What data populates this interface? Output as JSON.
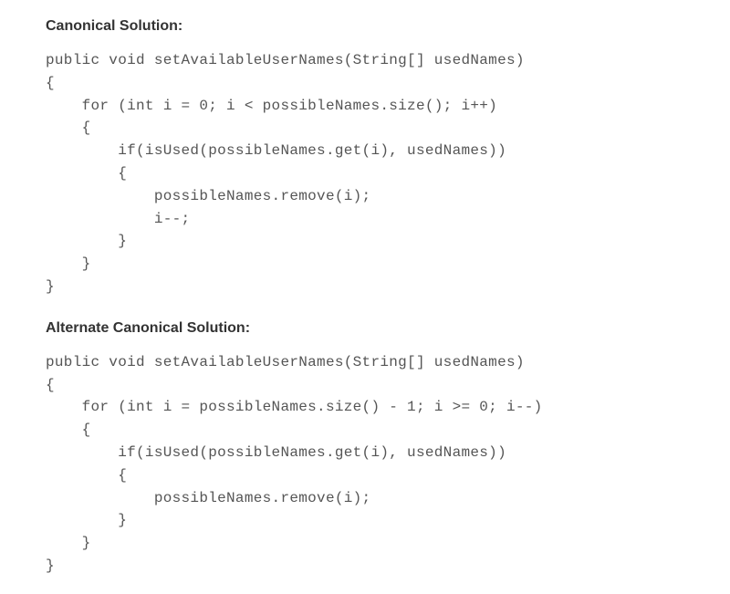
{
  "section1": {
    "heading": "Canonical Solution:",
    "code": "public void setAvailableUserNames(String[] usedNames)\n{\n    for (int i = 0; i < possibleNames.size(); i++)\n    {\n        if(isUsed(possibleNames.get(i), usedNames))\n        {\n            possibleNames.remove(i);\n            i--;\n        }\n    }\n}"
  },
  "section2": {
    "heading": "Alternate Canonical Solution:",
    "code": "public void setAvailableUserNames(String[] usedNames)\n{\n    for (int i = possibleNames.size() - 1; i >= 0; i--)\n    {\n        if(isUsed(possibleNames.get(i), usedNames))\n        {\n            possibleNames.remove(i);\n        }\n    }\n}"
  }
}
